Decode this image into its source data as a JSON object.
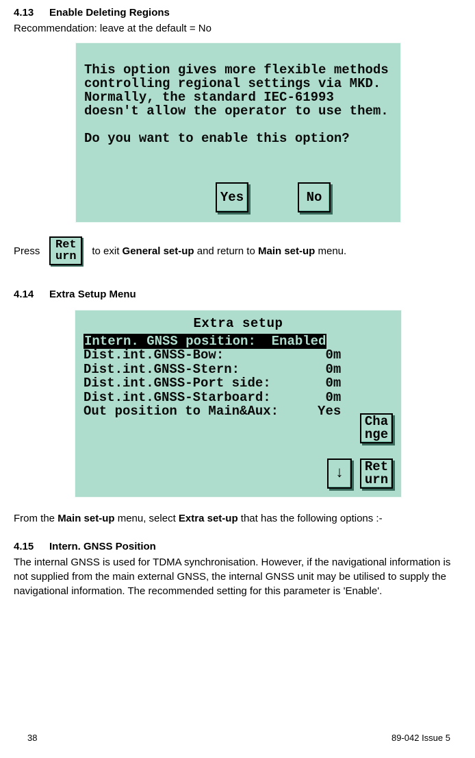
{
  "section_413": {
    "number": "4.13",
    "title": "Enable Deleting Regions",
    "recommendation": "Recommendation: leave at the default = No"
  },
  "dialog1": {
    "line1": "This option gives more flexible methods",
    "line2": "controlling regional settings via MKD.",
    "line3": "Normally, the standard IEC-61993",
    "line4": "doesn't allow the operator to use them.",
    "prompt": "Do you want to enable this option?",
    "yes": "Yes",
    "no": "No"
  },
  "press_line": {
    "press": "Press",
    "return_btn": "Ret\nurn",
    "after": "to exit",
    "bold1": "General set-up",
    "mid": "and return to",
    "bold2": "Main set-up",
    "end": "menu."
  },
  "section_414": {
    "number": "4.14",
    "title": "Extra Setup Menu"
  },
  "extra_setup": {
    "title": "Extra setup",
    "rows": [
      {
        "label": "Intern. GNSS position:",
        "value": "Enabled",
        "hl": true
      },
      {
        "label": "Dist.int.GNSS-Bow:",
        "value": "0m",
        "hl": false
      },
      {
        "label": "Dist.int.GNSS-Stern:",
        "value": "0m",
        "hl": false
      },
      {
        "label": "Dist.int.GNSS-Port side:",
        "value": "0m",
        "hl": false
      },
      {
        "label": "Dist.int.GNSS-Starboard:",
        "value": "0m",
        "hl": false
      },
      {
        "label": "Out position to Main&Aux:",
        "value": "Yes",
        "hl": false
      }
    ],
    "change_btn": "Cha\nnge",
    "down_btn": "↓",
    "return_btn": "Ret\nurn"
  },
  "after_extra": {
    "pre": "From the",
    "bold1": "Main set-up",
    "mid": "menu, select",
    "bold2": "Extra set-up",
    "post": "that has the following options :-"
  },
  "section_415": {
    "number": "4.15",
    "title": "Intern. GNSS Position",
    "body": "The internal GNSS is used for TDMA synchronisation. However, if the navigational information is not supplied from the main external GNSS, the internal GNSS unit may be utilised to supply the navigational information. The recommended setting for this parameter is 'Enable'."
  },
  "footer": {
    "page": "38",
    "doc": "89-042 Issue 5"
  }
}
